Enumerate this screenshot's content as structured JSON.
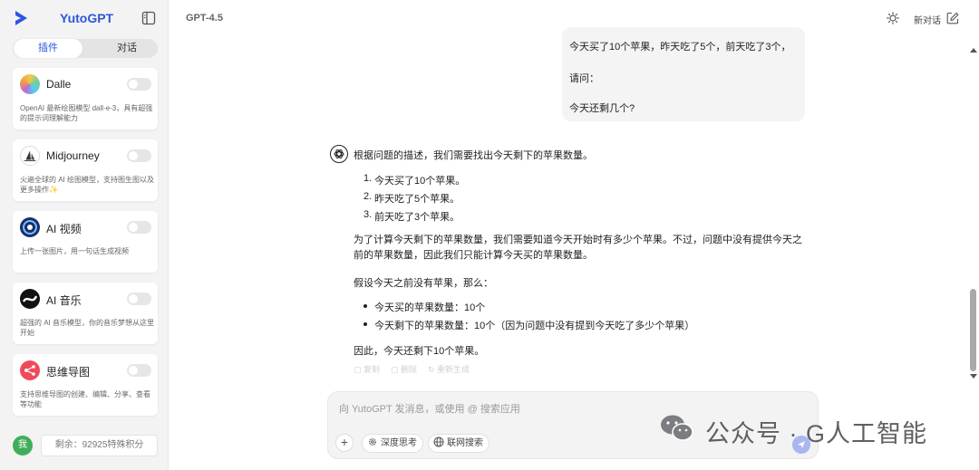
{
  "sidebar": {
    "brand": "YutoGPT",
    "tabs": [
      {
        "label": "插件",
        "active": true
      },
      {
        "label": "对话",
        "active": false
      }
    ],
    "plugins": [
      {
        "name": "Dalle",
        "desc": "OpenAI 最新绘图模型 dall-e-3，具有超强的提示词理解能力",
        "icon": "dalle-icon",
        "enabled": false
      },
      {
        "name": "Midjourney",
        "desc": "火遍全球的 AI 绘图模型，支持图生图以及更多操作✨",
        "icon": "midjourney-icon",
        "enabled": false
      },
      {
        "name": "AI 视频",
        "desc": "上传一张图片，用一句话生成视频",
        "icon": "ai-video-icon",
        "enabled": false
      },
      {
        "name": "AI 音乐",
        "desc": "超强的 AI 音乐模型，你的音乐梦想从这里开始",
        "icon": "ai-music-icon",
        "enabled": false
      },
      {
        "name": "思维导图",
        "desc": "支持思维导图的创建、编辑、分享、查看等功能",
        "icon": "mindmap-icon",
        "enabled": false
      }
    ],
    "avatar_label": "我",
    "credit": "剩余：92925特殊积分"
  },
  "header": {
    "model": "GPT-4.5",
    "new_chat": "新对话"
  },
  "chat": {
    "user_message": [
      "今天买了10个苹果，昨天吃了5个，前天吃了3个，",
      "请问：",
      "今天还剩几个?"
    ],
    "ai": {
      "intro": "根据问题的描述，我们需要找出今天剩下的苹果数量。",
      "steps": [
        "今天买了10个苹果。",
        "昨天吃了5个苹果。",
        "前天吃了3个苹果。"
      ],
      "para1": "为了计算今天剩下的苹果数量，我们需要知道今天开始时有多少个苹果。不过，问题中没有提供今天之前的苹果数量，因此我们只能计算今天买的苹果数量。",
      "assume": "假设今天之前没有苹果，那么：",
      "bullets": [
        "今天买的苹果数量：10个",
        "今天剩下的苹果数量：10个（因为问题中没有提到今天吃了多少个苹果）"
      ],
      "conclusion": "因此，今天还剩下10个苹果。",
      "actions": [
        "复制",
        "删除",
        "重新生成"
      ]
    }
  },
  "input": {
    "placeholder": "向 YutoGPT 发消息，或使用 @ 搜索应用",
    "plus": "+",
    "deep_think": "深度思考",
    "web_search": "联网搜索"
  },
  "watermark": "公众号 · G人工智能",
  "colors": {
    "brand": "#2b58d8",
    "send": "#a9b7f0"
  }
}
